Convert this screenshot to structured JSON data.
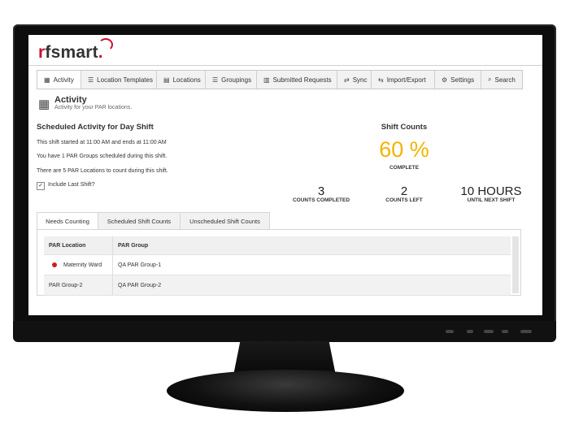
{
  "brand": {
    "logo_text": "rfsmart",
    "logo_dot": "."
  },
  "nav": [
    {
      "label": "Activity",
      "icon": "calendar-icon"
    },
    {
      "label": "Location Templates",
      "icon": "list-icon"
    },
    {
      "label": "Locations",
      "icon": "clipboard-icon"
    },
    {
      "label": "Groupings",
      "icon": "list-icon"
    },
    {
      "label": "Submitted Requests",
      "icon": "document-icon"
    },
    {
      "label": "Sync",
      "icon": "sync-icon"
    },
    {
      "label": "Import/Export",
      "icon": "transfer-icon"
    },
    {
      "label": "Settings",
      "icon": "gear-icon"
    },
    {
      "label": "Search",
      "icon": "search-icon"
    }
  ],
  "page": {
    "title": "Activity",
    "subtitle": "Activity for your PAR locations."
  },
  "schedule": {
    "heading": "Scheduled Activity for Day Shift",
    "line1": "This shift started at 11:00 AM and ends at 11:00 AM",
    "line2": "You have 1 PAR Groups scheduled during this shift.",
    "line3": "There are 5 PAR Locations to count during this shift.",
    "include_last_shift_label": "Include Last Shift?",
    "include_last_shift_checked": true
  },
  "shift_counts": {
    "title": "Shift Counts",
    "percent": "60 %",
    "percent_label": "COMPLETE",
    "percent_color": "#f2b400",
    "counts_completed": "3",
    "counts_completed_label": "COUNTS COMPLETED",
    "counts_left": "2",
    "counts_left_label": "COUNTS LEFT",
    "hours": "10 HOURS",
    "hours_label": "UNTIL NEXT SHIFT"
  },
  "tabs": [
    "Needs Counting",
    "Scheduled Shift Counts",
    "Unscheduled Shift Counts"
  ],
  "table": {
    "columns": [
      "PAR Location",
      "PAR Group"
    ],
    "rows": [
      {
        "location": "Maternity Ward",
        "group": "QA PAR Group-1",
        "status_color": "#cc1f1f"
      },
      {
        "location": "PAR Group-2",
        "group": "QA PAR Group-2"
      }
    ]
  }
}
